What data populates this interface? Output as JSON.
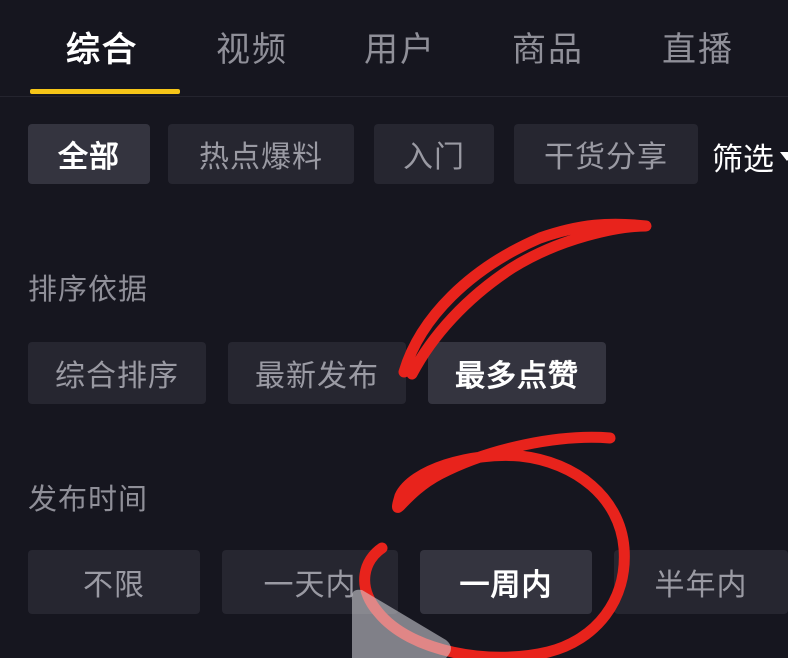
{
  "tabs": [
    {
      "label": "综合",
      "active": true
    },
    {
      "label": "视频",
      "active": false
    },
    {
      "label": "用户",
      "active": false
    },
    {
      "label": "商品",
      "active": false
    },
    {
      "label": "直播",
      "active": false
    }
  ],
  "categories": [
    {
      "label": "全部",
      "selected": true
    },
    {
      "label": "热点爆料",
      "selected": false
    },
    {
      "label": "入门",
      "selected": false
    },
    {
      "label": "干货分享",
      "selected": false
    }
  ],
  "filter_label": "筛选",
  "sort": {
    "heading": "排序依据",
    "options": [
      {
        "label": "综合排序",
        "selected": false
      },
      {
        "label": "最新发布",
        "selected": false
      },
      {
        "label": "最多点赞",
        "selected": true
      }
    ]
  },
  "publish_time": {
    "heading": "发布时间",
    "options": [
      {
        "label": "不限",
        "selected": false
      },
      {
        "label": "一天内",
        "selected": false
      },
      {
        "label": "一周内",
        "selected": true
      },
      {
        "label": "半年内",
        "selected": false
      }
    ]
  },
  "colors": {
    "background": "#16161f",
    "chip": "#262630",
    "chip_selected": "#34343f",
    "accent_underline": "#f5c518",
    "annotation": "#e8231c"
  }
}
